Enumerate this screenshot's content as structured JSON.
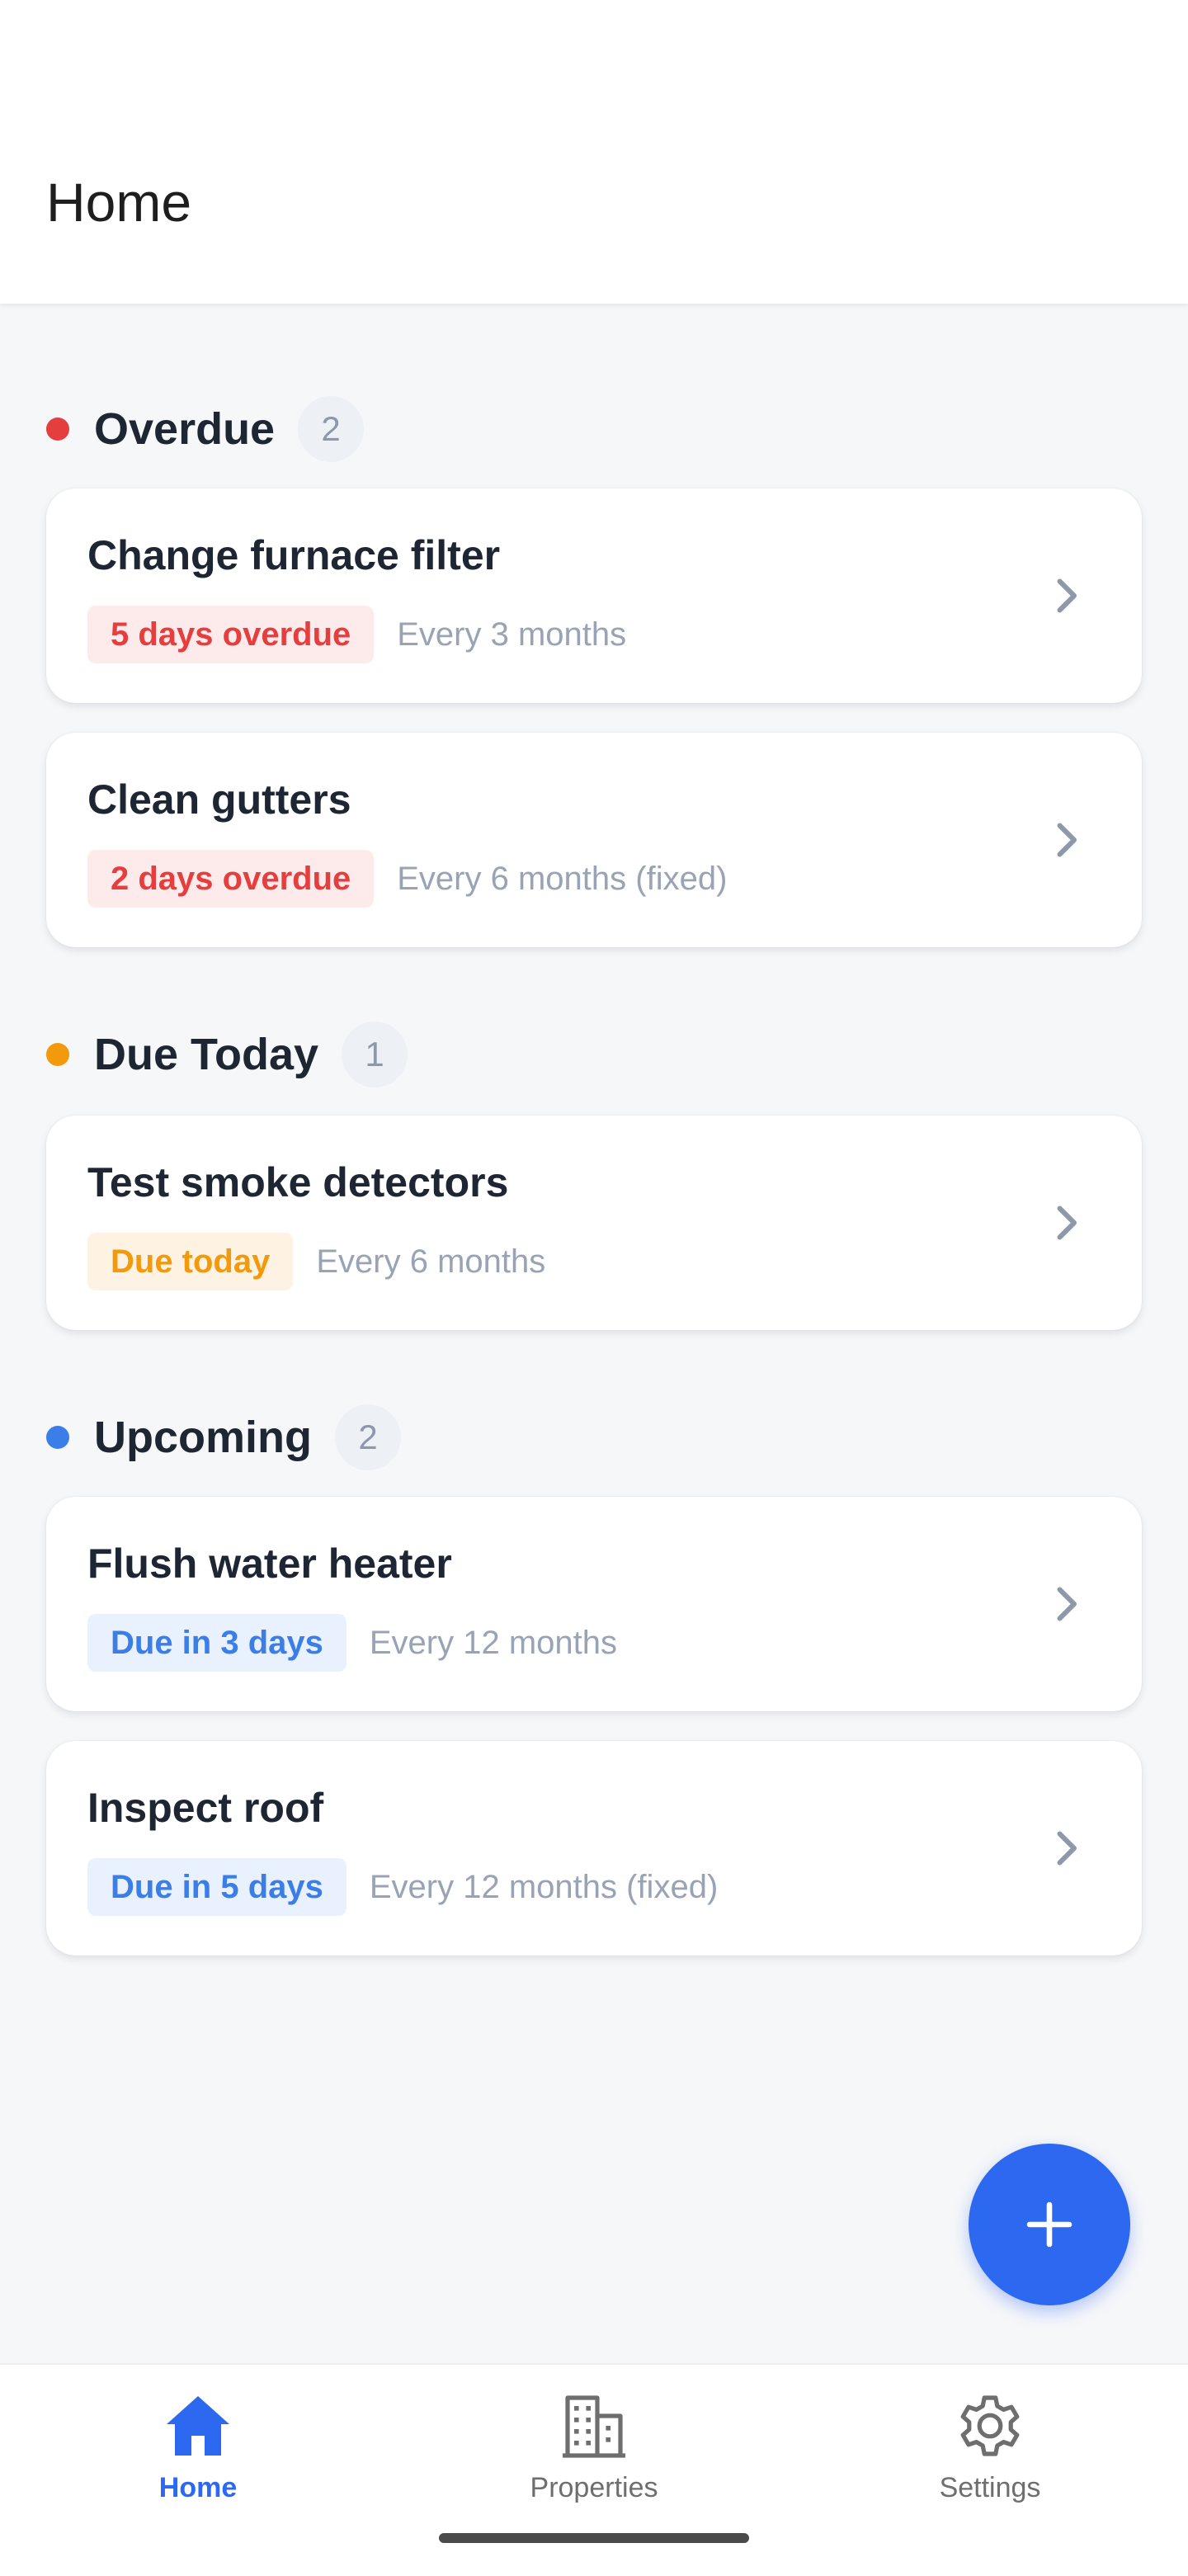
{
  "header": {
    "title": "Home"
  },
  "sections": [
    {
      "title": "Overdue",
      "count": "2",
      "dot_color": "#E53E3E",
      "tasks": [
        {
          "title": "Change furnace filter",
          "status": "5 days overdue",
          "frequency": "Every 3 months"
        },
        {
          "title": "Clean gutters",
          "status": "2 days overdue",
          "frequency": "Every 6 months (fixed)"
        }
      ]
    },
    {
      "title": "Due Today",
      "count": "1",
      "dot_color": "#F29A0B",
      "tasks": [
        {
          "title": "Test smoke detectors",
          "status": "Due today",
          "frequency": "Every 6 months"
        }
      ]
    },
    {
      "title": "Upcoming",
      "count": "2",
      "dot_color": "#3B7EE8",
      "tasks": [
        {
          "title": "Flush water heater",
          "status": "Due in 3 days",
          "frequency": "Every 12 months"
        },
        {
          "title": "Inspect roof",
          "status": "Due in 5 days",
          "frequency": "Every 12 months (fixed)"
        }
      ]
    }
  ],
  "fab": {
    "icon": "plus-icon",
    "color": "#2D68F0"
  },
  "bottom_nav": {
    "items": [
      {
        "label": "Home",
        "icon": "home-icon",
        "active": true
      },
      {
        "label": "Properties",
        "icon": "building-icon",
        "active": false
      },
      {
        "label": "Settings",
        "icon": "gear-icon",
        "active": false
      }
    ]
  },
  "colors": {
    "accent": "#2D68F0",
    "overdue": "#E53E3E",
    "today": "#F29A0B",
    "upcoming": "#3B7EE8"
  }
}
